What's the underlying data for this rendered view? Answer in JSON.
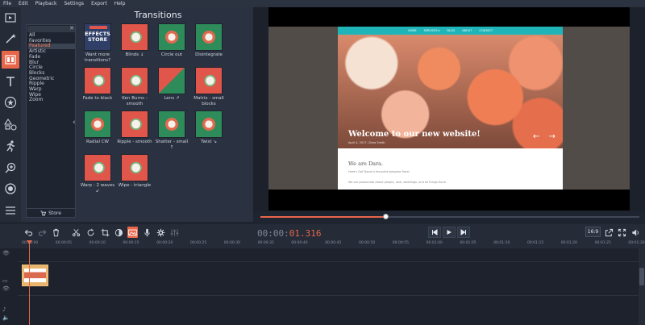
{
  "menu": [
    "File",
    "Edit",
    "Playback",
    "Settings",
    "Export",
    "Help"
  ],
  "tools": [
    {
      "name": "import-icon",
      "active": false
    },
    {
      "name": "magic-wand-icon",
      "active": false
    },
    {
      "name": "film-transitions-icon",
      "active": true
    },
    {
      "name": "text-icon",
      "active": false
    },
    {
      "name": "star-sticker-icon",
      "active": false
    },
    {
      "name": "shapes-icon",
      "active": false
    },
    {
      "name": "running-man-icon",
      "active": false
    },
    {
      "name": "zoom-icon",
      "active": false
    },
    {
      "name": "camera-record-icon",
      "active": false
    },
    {
      "name": "menu-list-icon",
      "active": false
    }
  ],
  "panel": {
    "title": "Transitions",
    "categories": [
      "All",
      "Favorites",
      "Featured",
      "Artistic",
      "Fade",
      "Blur",
      "Circle",
      "Blocks",
      "Geometric",
      "Ripple",
      "Warp",
      "Wipe",
      "Zoom"
    ],
    "selected_category": "Featured",
    "store_label": "Store",
    "store_tile_text": [
      "EFFECTS",
      "STORE"
    ],
    "transitions": [
      {
        "label": "Want more transitions?",
        "style": "store"
      },
      {
        "label": "Blinds ↓",
        "style": "red"
      },
      {
        "label": "Circle out",
        "style": "green"
      },
      {
        "label": "Disintegrate",
        "style": "green"
      },
      {
        "label": "Fade to black",
        "style": "red"
      },
      {
        "label": "Ken Burns - smooth",
        "style": "red"
      },
      {
        "label": "Lens ↗",
        "style": "mix"
      },
      {
        "label": "Matrix - small blocks",
        "style": "red"
      },
      {
        "label": "Radial CW",
        "style": "green"
      },
      {
        "label": "Ripple - smooth",
        "style": "red"
      },
      {
        "label": "Shatter - small ↑",
        "style": "green"
      },
      {
        "label": "Twist ↘",
        "style": "green"
      },
      {
        "label": "Warp - 2 waves ↙",
        "style": "red"
      },
      {
        "label": "Wipe - triangle",
        "style": "red"
      }
    ]
  },
  "preview": {
    "site_nav": [
      "HOME",
      "SERVICES ▾",
      "BLOG",
      "ABOUT",
      "CONTACT"
    ],
    "hero_title": "Welcome to our new website!",
    "hero_sub": "April 4, 2017  |  Dara Smith",
    "hero_arrows": "← →",
    "section_heading": "We are Dara.",
    "para1": "Here's Get Dazzy's favourite bespoke floral.",
    "para2": "We are passionate about people, love, weddings, and all things floral."
  },
  "playback": {
    "progress": 0.33,
    "timecode_lead": "00:00:",
    "timecode_rest": "01.316",
    "aspect": "16:9"
  },
  "ruler_ticks": [
    "00:00:00",
    "00:00:05",
    "00:00:10",
    "00:00:15",
    "00:00:20",
    "00:00:25",
    "00:00:30",
    "00:00:35",
    "00:00:40",
    "00:00:45",
    "00:00:50",
    "00:00:55",
    "00:01:00",
    "00:01:05",
    "00:01:10",
    "00:01:15",
    "00:01:20",
    "00:01:25",
    "00:01:30"
  ],
  "colors": {
    "accent": "#e8664a",
    "panel": "#2a3140",
    "teal": "#1fb5b8"
  }
}
